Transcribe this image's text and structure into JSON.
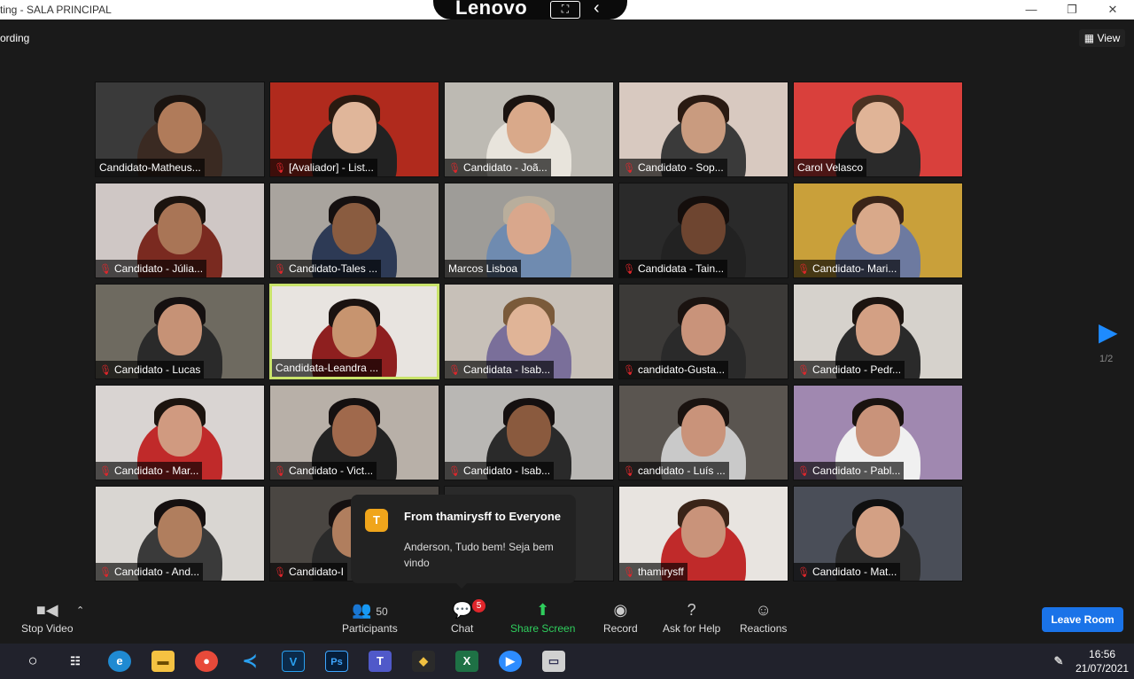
{
  "window": {
    "title": "ting - SALA PRINCIPAL",
    "brand": "Lenovo",
    "minimize": "—",
    "restore": "❐",
    "close": "✕"
  },
  "meeting": {
    "recording_label": "ording",
    "view_label": "View",
    "page_indicator": "1/2"
  },
  "tiles": [
    {
      "label": "Candidato-Matheus...",
      "muted": false,
      "bg": "#3a3a3a",
      "skin": "#b07b5a",
      "hair": "#1b1410",
      "shirt": "#3a2a22"
    },
    {
      "label": "[Avaliador] - List...",
      "muted": true,
      "bg": "#b02a1d",
      "skin": "#e0b69a",
      "hair": "#2a1a10",
      "shirt": "#222222"
    },
    {
      "label": "Candidato - Joã...",
      "muted": true,
      "bg": "#bdbab3",
      "skin": "#d9a98a",
      "hair": "#1a1310",
      "shirt": "#e8e4dc"
    },
    {
      "label": "Candidato - Sop...",
      "muted": true,
      "bg": "#d8c9c0",
      "skin": "#c99b7f",
      "hair": "#2a1a12",
      "shirt": "#3a3a3a"
    },
    {
      "label": "Carol Velasco",
      "muted": false,
      "bg": "#d9403c",
      "skin": "#e0b497",
      "hair": "#4b3222",
      "shirt": "#2a2a2a"
    },
    {
      "label": "Candidato - Júlia...",
      "muted": true,
      "bg": "#cfc7c5",
      "skin": "#a97556",
      "hair": "#1c140f",
      "shirt": "#7a2a20"
    },
    {
      "label": "Candidato-Tales ...",
      "muted": true,
      "bg": "#a9a49e",
      "skin": "#8a5c40",
      "hair": "#151010",
      "shirt": "#2d3a55"
    },
    {
      "label": "Marcos Lisboa",
      "muted": false,
      "bg": "#9e9c98",
      "skin": "#d9a78c",
      "hair": "#b9ae9c",
      "shirt": "#6f8bb0"
    },
    {
      "label": "Candidata - Tain...",
      "muted": true,
      "bg": "#2a2a2a",
      "skin": "#6e4530",
      "hair": "#140e0c",
      "shirt": "#222222"
    },
    {
      "label": "Candidato- Mari...",
      "muted": true,
      "bg": "#c9a03a",
      "skin": "#d9a98a",
      "hair": "#3a2418",
      "shirt": "#6d7aa0"
    },
    {
      "label": "Candidato - Lucas",
      "muted": true,
      "bg": "#6e6a60",
      "skin": "#c69276",
      "hair": "#151010",
      "shirt": "#2a2a2a"
    },
    {
      "label": "Candidata-Leandra ...",
      "muted": false,
      "bg": "#e8e4e0",
      "skin": "#c7946f",
      "hair": "#1a1210",
      "shirt": "#8e1f1f"
    },
    {
      "label": "Candidata - Isab...",
      "muted": true,
      "bg": "#c7c0b8",
      "skin": "#e0b497",
      "hair": "#7a5a3a",
      "shirt": "#7a6f9a"
    },
    {
      "label": "candidato-Gusta...",
      "muted": true,
      "bg": "#3c3a38",
      "skin": "#c9937a",
      "hair": "#1a1310",
      "shirt": "#2a2a2a"
    },
    {
      "label": "Candidato - Pedr...",
      "muted": true,
      "bg": "#d6d2cc",
      "skin": "#d3a084",
      "hair": "#1c1410",
      "shirt": "#2a2a2a"
    },
    {
      "label": "Candidato - Mar...",
      "muted": true,
      "bg": "#d9d4d2",
      "skin": "#d09a80",
      "hair": "#1c140f",
      "shirt": "#c02a2a"
    },
    {
      "label": "Candidato - Vict...",
      "muted": true,
      "bg": "#b8b0a8",
      "skin": "#a0694c",
      "hair": "#151010",
      "shirt": "#222222"
    },
    {
      "label": "Candidato - Isab...",
      "muted": true,
      "bg": "#b9b7b4",
      "skin": "#8a5a3e",
      "hair": "#151010",
      "shirt": "#2a2a2a"
    },
    {
      "label": "candidato - Luís ...",
      "muted": true,
      "bg": "#5a5550",
      "skin": "#c9937a",
      "hair": "#1a1310",
      "shirt": "#c9c9c9"
    },
    {
      "label": "Candidato - Pabl...",
      "muted": true,
      "bg": "#a088b0",
      "skin": "#c9937a",
      "hair": "#1a1310",
      "shirt": "#f0f0f0"
    },
    {
      "label": "Candidato - And...",
      "muted": true,
      "bg": "#d9d6d2",
      "skin": "#b07e5e",
      "hair": "#151010",
      "shirt": "#3a3a3a"
    },
    {
      "label": "Candidato-I",
      "muted": true,
      "bg": "#4a4642",
      "skin": "#b07e5e",
      "hair": "#151010",
      "shirt": "#2a2a2a"
    },
    {
      "label": "",
      "muted": false,
      "bg": "#2a2a2a",
      "skin": "#2a2a2a",
      "hair": "#2a2a2a",
      "shirt": "#2a2a2a"
    },
    {
      "label": "thamirysff",
      "muted": true,
      "bg": "#e8e4e0",
      "skin": "#c9937a",
      "hair": "#3a2418",
      "shirt": "#c02a2a"
    },
    {
      "label": "Candidato - Mat...",
      "muted": true,
      "bg": "#4a4e58",
      "skin": "#d3a084",
      "hair": "#101010",
      "shirt": "#2a2a2a"
    }
  ],
  "chat_popup": {
    "avatar_letter": "T",
    "from": "From thamirysff to Everyone",
    "message": "Anderson, Tudo bem! Seja bem vindo"
  },
  "toolbar": {
    "stop_video": "Stop Video",
    "participants_label": "Participants",
    "participants_count": "50",
    "chat_label": "Chat",
    "chat_badge": "5",
    "share_label": "Share Screen",
    "record_label": "Record",
    "help_label": "Ask for Help",
    "reactions_label": "Reactions",
    "leave_label": "Leave Room"
  },
  "taskbar": {
    "time": "16:56",
    "date": "21/07/2021",
    "icons": [
      "cortana-icon",
      "task-view-icon",
      "edge-icon",
      "file-explorer-icon",
      "chrome-icon",
      "vscode-icon",
      "v-app-icon",
      "photoshop-icon",
      "teams-icon",
      "git-icon",
      "excel-icon",
      "zoom-icon",
      "remote-desktop-icon"
    ]
  },
  "colors": {
    "active_speaker_border": "#c9e36a",
    "share_green": "#2fce5d",
    "leave_blue": "#1a73e8",
    "muted_red": "#e0262b"
  }
}
